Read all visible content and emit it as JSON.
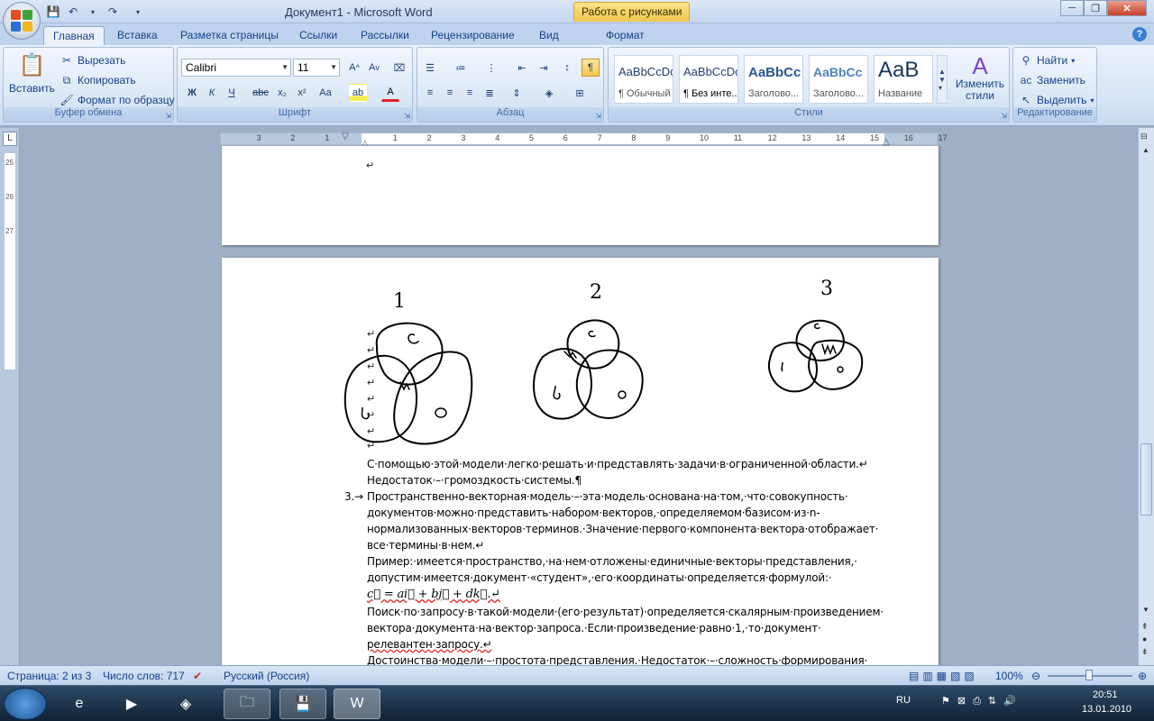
{
  "window": {
    "title": "Документ1 - Microsoft Word",
    "context_tab": "Работа с рисунками"
  },
  "tabs": [
    "Главная",
    "Вставка",
    "Разметка страницы",
    "Ссылки",
    "Рассылки",
    "Рецензирование",
    "Вид",
    "Формат"
  ],
  "ribbon": {
    "clipboard": {
      "label": "Буфер обмена",
      "paste": "Вставить",
      "cut": "Вырезать",
      "copy": "Копировать",
      "format_painter": "Формат по образцу"
    },
    "font": {
      "label": "Шрифт",
      "family": "Calibri",
      "size": "11"
    },
    "paragraph": {
      "label": "Абзац"
    },
    "styles": {
      "label": "Стили",
      "items": [
        {
          "sample": "AaBbCcDc",
          "name": "¶ Обычный"
        },
        {
          "sample": "AaBbCcDc",
          "name": "¶ Без инте..."
        },
        {
          "sample": "AaBbCc",
          "name": "Заголово..."
        },
        {
          "sample": "AaBbCc",
          "name": "Заголово..."
        },
        {
          "sample": "AaB",
          "name": "Название"
        }
      ],
      "change_styles": "Изменить стили"
    },
    "editing": {
      "label": "Редактирование",
      "find": "Найти",
      "replace": "Заменить",
      "select": "Выделить"
    }
  },
  "ruler": {
    "ticks": [
      "3",
      "2",
      "1",
      "1",
      "2",
      "3",
      "4",
      "5",
      "6",
      "7",
      "8",
      "9",
      "10",
      "11",
      "12",
      "13",
      "14",
      "15",
      "16",
      "17"
    ]
  },
  "vruler": {
    "ticks": [
      "25",
      "26",
      "27"
    ]
  },
  "figures": {
    "labels": [
      "1",
      "2",
      "3"
    ]
  },
  "document": {
    "lines": [
      "С·помощью·этой·модели·легко·решать·и·представлять·задачи·в·ограниченной·области.↵",
      "Недостаток·–·громоздкость·системы.¶",
      "Пространственно-векторная·модель·–·эта·модель·основана·на·том,·что·совокупность·",
      "документов·можно·представить·набором·векторов,·определяемом·базисом·из·n-",
      "нормализованных·векторов·терминов.·Значение·первого·компонента·вектора·отображает·",
      "все·термины·в·нем.↵",
      "Пример:·имеется·пространство,·на·нем·отложены·единичные·векторы·представления,·",
      "допустим·имеется·документ·«студент»,·его·координаты·определяется·формулой:·",
      "c⃗ = ai⃗ + bj⃗ + dk⃗.↵",
      "Поиск·по·запросу·в·такой·модели·(его·результат)·определяется·скалярным·произведением·",
      "вектора·документа·на·вектор·запроса.·Если·произведение·равно·1,·то·документ·",
      "релевантен·запросу.↵",
      "Достоинства·модели·–·простота·представления.·Недостаток·–·сложность·формирования·"
    ],
    "list_number": "3.→"
  },
  "statusbar": {
    "page": "Страница: 2 из 3",
    "words": "Число слов: 717",
    "language": "Русский (Россия)",
    "zoom": "100%"
  },
  "taskbar": {
    "lang": "RU",
    "time": "20:51",
    "date": "13.01.2010"
  },
  "colors": {
    "ribbon_bg": "#d5e3f4",
    "context_tab": "#f0c54c",
    "text_blue": "#15428b"
  }
}
